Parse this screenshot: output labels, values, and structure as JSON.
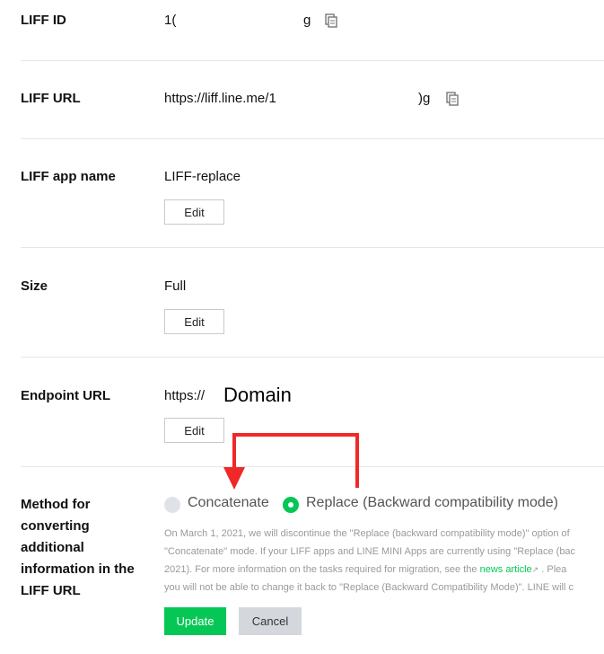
{
  "fields": {
    "liff_id": {
      "label": "LIFF ID",
      "value_start": "1(",
      "value_end": "g"
    },
    "liff_url": {
      "label": "LIFF URL",
      "value_start": "https://liff.line.me/1",
      "value_end": ")g"
    },
    "app_name": {
      "label": "LIFF app name",
      "value": "LIFF-replace",
      "edit": "Edit"
    },
    "size": {
      "label": "Size",
      "value": "Full",
      "edit": "Edit"
    },
    "endpoint": {
      "label": "Endpoint URL",
      "value": "https://",
      "annotation": "Domain",
      "edit": "Edit"
    },
    "method": {
      "label_lines": [
        "Method for",
        "converting",
        "additional",
        "information in the",
        "LIFF URL"
      ],
      "options": [
        {
          "label": "Concatenate",
          "selected": false
        },
        {
          "label": "Replace (Backward compatibility mode)",
          "selected": true
        }
      ],
      "note_lines": [
        "On March 1, 2021, we will discontinue the \"Replace (backward compatibility mode)\" option of",
        "\"Concatenate\" mode. If your LIFF apps and LINE MINI Apps are currently using \"Replace (bac",
        "2021). For more information on the tasks required for migration, see the",
        "you will not be able to change it back to \"Replace (Backward Compatibility Mode)\". LINE will c"
      ],
      "note_link": "news article",
      "note_after_link": ". Plea"
    }
  },
  "actions": {
    "update": "Update",
    "cancel": "Cancel"
  },
  "colors": {
    "accent": "#06c755",
    "annotation_arrow": "#f02828"
  }
}
